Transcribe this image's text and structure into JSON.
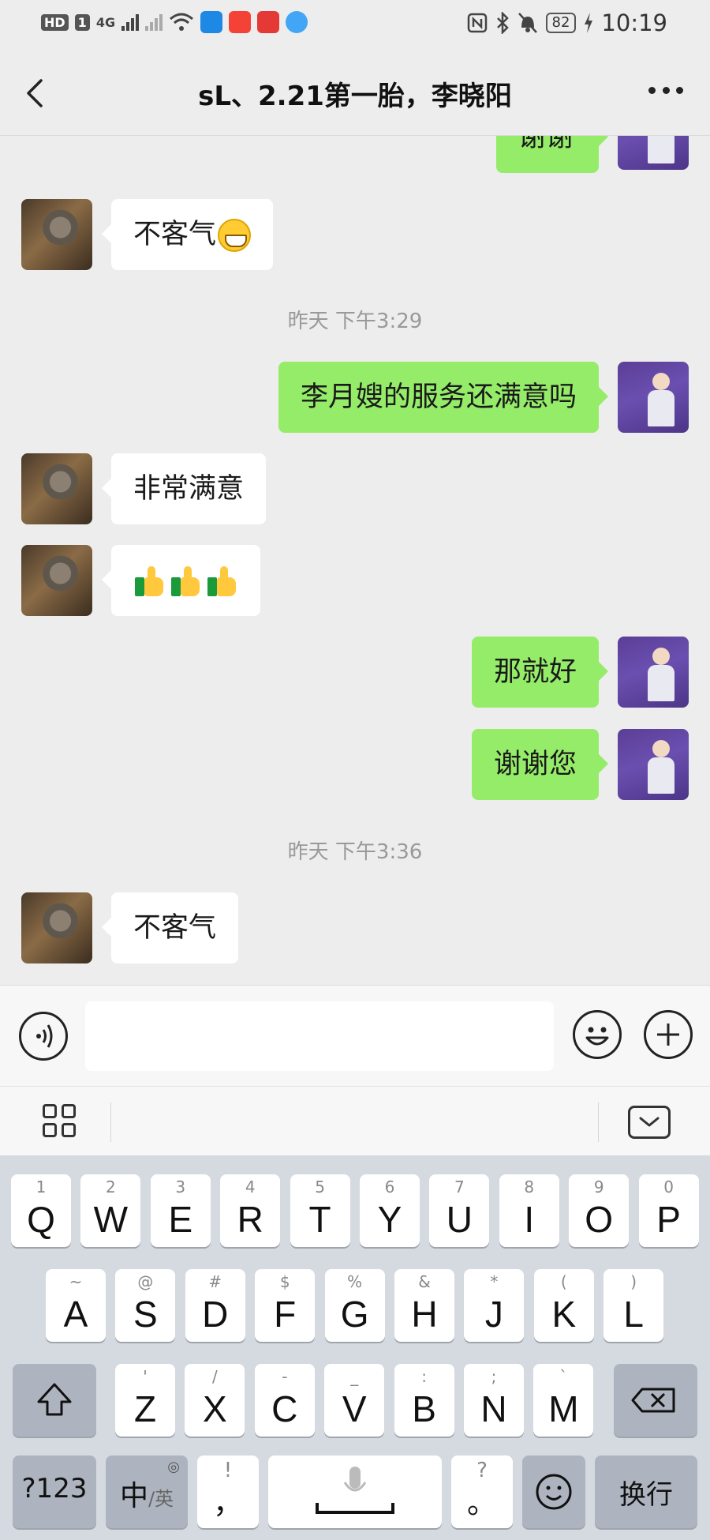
{
  "status_bar": {
    "badges": [
      "HD",
      "1"
    ],
    "network": "4G",
    "battery": "82",
    "time": "10:19"
  },
  "nav": {
    "title": "sL、2.21第一胎，李晓阳"
  },
  "messages": {
    "m0": "谢谢",
    "m1": "不客气",
    "time1": "昨天 下午3:29",
    "m2": "李月嫂的服务还满意吗",
    "m3": "非常满意",
    "m5": "那就好",
    "m6": "谢谢您",
    "time2": "昨天 下午3:36",
    "m7": "不客气"
  },
  "input": {
    "value": ""
  },
  "keyboard": {
    "row1": [
      {
        "hint": "1",
        "key": "Q"
      },
      {
        "hint": "2",
        "key": "W"
      },
      {
        "hint": "3",
        "key": "E"
      },
      {
        "hint": "4",
        "key": "R"
      },
      {
        "hint": "5",
        "key": "T"
      },
      {
        "hint": "6",
        "key": "Y"
      },
      {
        "hint": "7",
        "key": "U"
      },
      {
        "hint": "8",
        "key": "I"
      },
      {
        "hint": "9",
        "key": "O"
      },
      {
        "hint": "0",
        "key": "P"
      }
    ],
    "row2": [
      {
        "hint": "~",
        "key": "A"
      },
      {
        "hint": "@",
        "key": "S"
      },
      {
        "hint": "#",
        "key": "D"
      },
      {
        "hint": "$",
        "key": "F"
      },
      {
        "hint": "%",
        "key": "G"
      },
      {
        "hint": "&",
        "key": "H"
      },
      {
        "hint": "*",
        "key": "J"
      },
      {
        "hint": "(",
        "key": "K"
      },
      {
        "hint": ")",
        "key": "L"
      }
    ],
    "row3": [
      {
        "hint": "'",
        "key": "Z"
      },
      {
        "hint": "/",
        "key": "X"
      },
      {
        "hint": "-",
        "key": "C"
      },
      {
        "hint": "_",
        "key": "V"
      },
      {
        "hint": ":",
        "key": "B"
      },
      {
        "hint": ";",
        "key": "N"
      },
      {
        "hint": "`",
        "key": "M"
      }
    ],
    "numbers_key": "?123",
    "lang_key_main": "中",
    "lang_key_sub": "/英",
    "comma_hint": "!",
    "comma_key": "，",
    "period_hint": "?",
    "period_key": "。",
    "enter_key": "换行"
  }
}
